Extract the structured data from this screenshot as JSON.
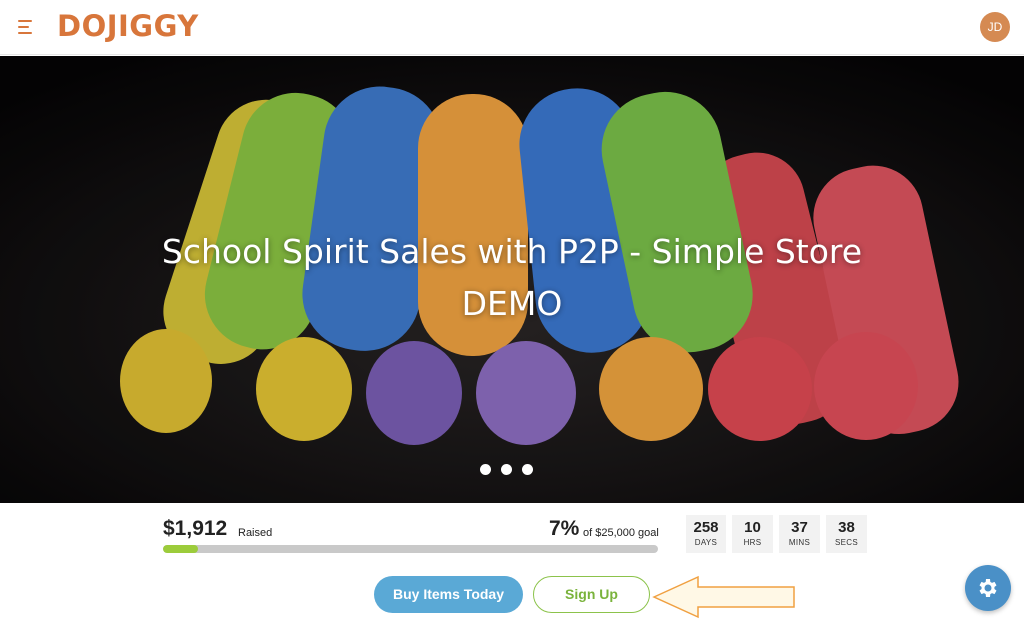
{
  "header": {
    "logo": "DOJIGGY",
    "avatar_initials": "JD"
  },
  "hero": {
    "title": "School Spirit Sales with P2P - Simple Store DEMO",
    "slides": 3
  },
  "campaign": {
    "raised_amount": "$1,912",
    "raised_label": "Raised",
    "percent": "7%",
    "goal_text": "of $25,000 goal",
    "progress_fraction": 0.07
  },
  "countdown": [
    {
      "value": "258",
      "label": "DAYS"
    },
    {
      "value": "10",
      "label": "HRS"
    },
    {
      "value": "37",
      "label": "MINS"
    },
    {
      "value": "38",
      "label": "SECS"
    }
  ],
  "actions": {
    "buy_label": "Buy Items Today",
    "signup_label": "Sign Up"
  },
  "colors": {
    "brand": "#d8763b",
    "progress": "#9ccc3b",
    "primary_button": "#5aa9d6",
    "secondary_button": "#7ab33c",
    "arrow_fill": "#fff8e6",
    "arrow_stroke": "#f0a041"
  },
  "icons": {
    "menu": "menu-icon",
    "settings": "gear-icon"
  }
}
